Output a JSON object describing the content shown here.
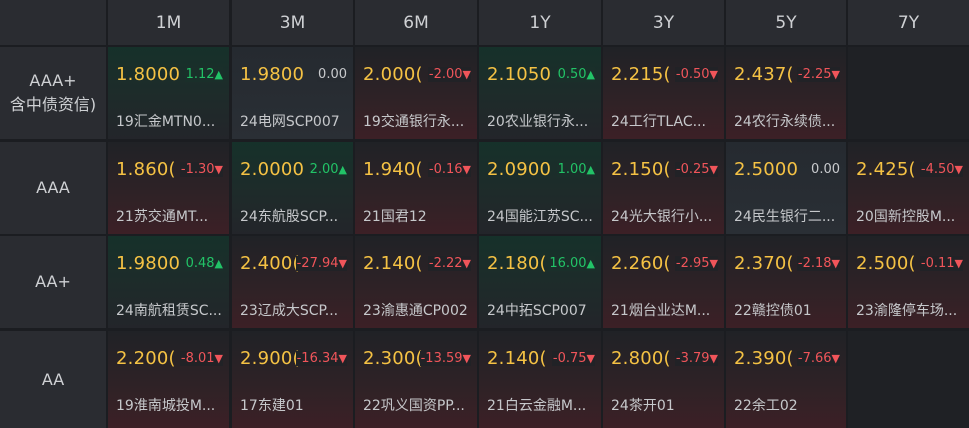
{
  "columns": [
    "1M",
    "3M",
    "6M",
    "1Y",
    "3Y",
    "5Y",
    "7Y"
  ],
  "rows": [
    {
      "label_lines": [
        "AAA+",
        "含中债资信)"
      ],
      "cells": [
        {
          "yield": "1.8000",
          "change": "1.12",
          "dir": "up",
          "name": "19汇金MTN0..."
        },
        {
          "yield": "1.9800",
          "change": "0.00",
          "dir": "flat",
          "name": "24电网SCP007"
        },
        {
          "yield": "2.000(",
          "change": "-2.00",
          "dir": "down",
          "name": "19交通银行永..."
        },
        {
          "yield": "2.1050",
          "change": "0.50",
          "dir": "up",
          "name": "20农业银行永..."
        },
        {
          "yield": "2.215(",
          "change": "-0.50",
          "dir": "down",
          "name": "24工行TLAC..."
        },
        {
          "yield": "2.437(",
          "change": "-2.25",
          "dir": "down",
          "name": "24农行永续债..."
        },
        null
      ]
    },
    {
      "label_lines": [
        "AAA"
      ],
      "cells": [
        {
          "yield": "1.860(",
          "change": "-1.30",
          "dir": "down",
          "name": "21苏交通MT..."
        },
        {
          "yield": "2.0000",
          "change": "2.00",
          "dir": "up",
          "name": "24东航股SCP..."
        },
        {
          "yield": "1.940(",
          "change": "-0.16",
          "dir": "down",
          "name": "21国君12"
        },
        {
          "yield": "2.0900",
          "change": "1.00",
          "dir": "up",
          "name": "24国能江苏SC..."
        },
        {
          "yield": "2.150(",
          "change": "-0.25",
          "dir": "down",
          "name": "24光大银行小..."
        },
        {
          "yield": "2.5000",
          "change": "0.00",
          "dir": "flat",
          "name": "24民生银行二..."
        },
        {
          "yield": "2.425(",
          "change": "-4.50",
          "dir": "down",
          "name": "20国新控股M..."
        }
      ]
    },
    {
      "label_lines": [
        "AA+"
      ],
      "cells": [
        {
          "yield": "1.9800",
          "change": "0.48",
          "dir": "up",
          "name": "24南航租赁SC..."
        },
        {
          "yield": "2.400(",
          "change": "-27.94",
          "dir": "down",
          "name": "23辽成大SCP..."
        },
        {
          "yield": "2.140(",
          "change": "-2.22",
          "dir": "down",
          "name": "23渝惠通CP002"
        },
        {
          "yield": "2.180(",
          "change": "16.00",
          "dir": "up",
          "name": "24中拓SCP007"
        },
        {
          "yield": "2.260(",
          "change": "-2.95",
          "dir": "down",
          "name": "21烟台业达M..."
        },
        {
          "yield": "2.370(",
          "change": "-2.18",
          "dir": "down",
          "name": "22赣控债01"
        },
        {
          "yield": "2.500(",
          "change": "-0.11",
          "dir": "down",
          "name": "23渝隆停车场..."
        }
      ]
    },
    {
      "label_lines": [
        "AA"
      ],
      "cells": [
        {
          "yield": "2.200(",
          "change": "-8.01",
          "dir": "down",
          "name": "19淮南城投M..."
        },
        {
          "yield": "2.900(",
          "change": "-16.34",
          "dir": "down",
          "name": "17东建01"
        },
        {
          "yield": "2.300(",
          "change": "-13.59",
          "dir": "down",
          "name": "22巩义国资PP..."
        },
        {
          "yield": "2.140(",
          "change": "-0.75",
          "dir": "down",
          "name": "21白云金融M..."
        },
        {
          "yield": "2.800(",
          "change": "-3.79",
          "dir": "down",
          "name": "24茶开01"
        },
        {
          "yield": "2.390(",
          "change": "-7.66",
          "dir": "down",
          "name": "22余工02"
        },
        null
      ]
    }
  ],
  "arrows": {
    "up": "▲",
    "down": "▼",
    "flat": ""
  },
  "colors": {
    "up": "#22c367",
    "down": "#f0555a",
    "flat": "#c8cacd",
    "yield": "#f5c244",
    "header_bg": "#2a2c31",
    "page_bg": "#1b1d21"
  }
}
